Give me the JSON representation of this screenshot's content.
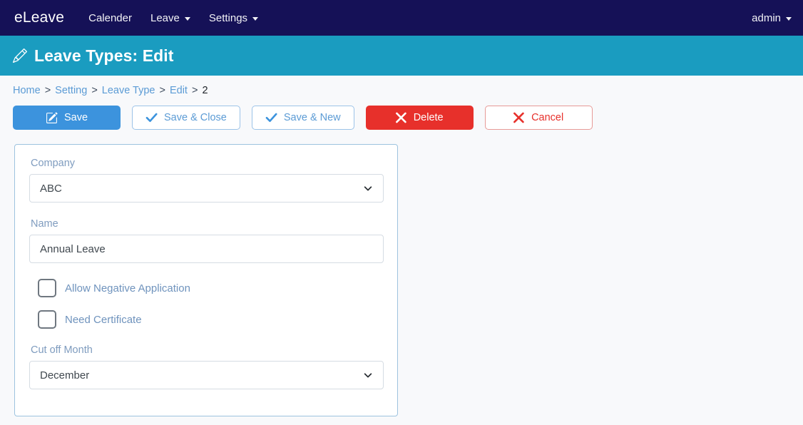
{
  "navbar": {
    "brand": "eLeave",
    "items": [
      {
        "label": "Calender",
        "has_caret": false,
        "icon": ""
      },
      {
        "label": "Leave",
        "has_caret": true,
        "icon": "caret-down-icon"
      },
      {
        "label": "Settings",
        "has_caret": true,
        "icon": "caret-down-icon"
      }
    ],
    "user": {
      "label": "admin",
      "icon": "caret-down-icon"
    },
    "background_color": "#151157"
  },
  "page_header": {
    "title": "Leave Types: Edit",
    "icon": "pencil-icon",
    "background_color": "#1a9cc0"
  },
  "breadcrumb": {
    "items": [
      {
        "label": "Home",
        "link": true
      },
      {
        "label": "Setting",
        "link": true
      },
      {
        "label": "Leave Type",
        "link": true
      },
      {
        "label": "Edit",
        "link": true
      },
      {
        "label": "2",
        "link": false
      }
    ],
    "separator": ">"
  },
  "toolbar": {
    "save_label": "Save",
    "save_icon": "pencil-square-icon",
    "save_close_label": "Save & Close",
    "save_close_icon": "check-icon",
    "save_new_label": "Save & New",
    "save_new_icon": "check-icon",
    "delete_label": "Delete",
    "delete_icon": "x-mark-icon",
    "cancel_label": "Cancel",
    "cancel_icon": "x-mark-icon",
    "primary_color": "#3c93dd",
    "danger_color": "#e7302b"
  },
  "form": {
    "company": {
      "label": "Company",
      "value": "ABC",
      "options": [
        "ABC"
      ],
      "icon": "chevron-down-icon"
    },
    "name": {
      "label": "Name",
      "value": "Annual Leave",
      "placeholder": ""
    },
    "allow_negative": {
      "label": "Allow Negative Application",
      "checked": false
    },
    "need_certificate": {
      "label": "Need Certificate",
      "checked": false
    },
    "cut_off_month": {
      "label": "Cut off Month",
      "value": "December",
      "options": [
        "December"
      ],
      "icon": "chevron-down-icon"
    }
  }
}
